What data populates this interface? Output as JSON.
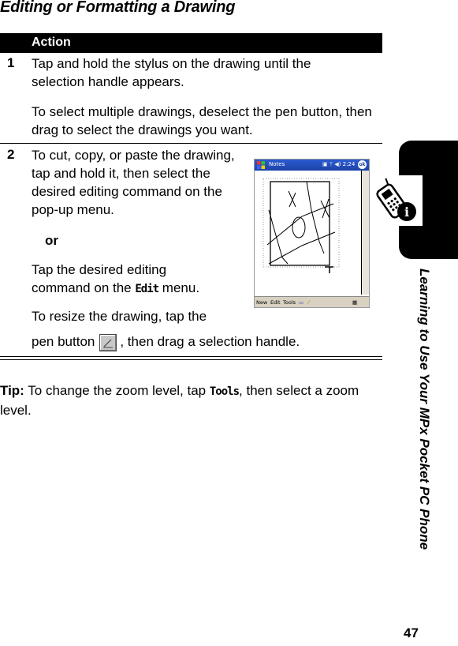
{
  "title": "Editing or Formatting a Drawing",
  "table": {
    "header": "Action",
    "steps": [
      {
        "number": "1",
        "paragraphs": [
          "Tap and hold the stylus on the drawing until the selection handle appears.",
          "To select multiple drawings, deselect the pen button, then drag to select the drawings you want."
        ]
      },
      {
        "number": "2",
        "text_a": "To cut, copy, or paste the drawing, tap and hold it, then select the desired editing command on the pop-up menu.",
        "or_label": "or",
        "text_b_pre": "Tap the desired editing command on the ",
        "text_b_cmd": "Edit",
        "text_b_post": " menu.",
        "text_c_line1": "To resize the drawing, tap the",
        "text_c_pre": "pen button",
        "text_c_post": ", then drag a selection handle."
      }
    ]
  },
  "tip": {
    "label": "Tip:",
    "pre": " To change the zoom level, tap ",
    "cmd": "Tools",
    "post": ", then select a zoom level."
  },
  "screenshot": {
    "app_title": "Notes",
    "time": "2:24",
    "ok_label": "ok",
    "menu": [
      "New",
      "Edit",
      "Tools"
    ]
  },
  "sidebar": {
    "chapter_title": "Learning to Use Your MPx Pocket PC Phone",
    "icon": "phone-info-icon"
  },
  "page_number": "47"
}
